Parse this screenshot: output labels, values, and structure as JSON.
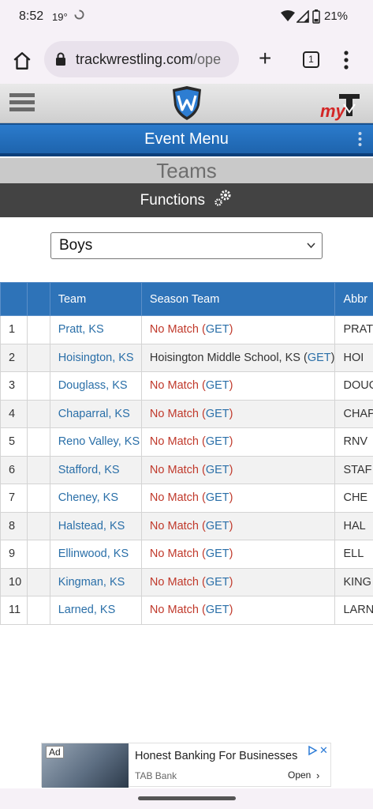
{
  "status_bar": {
    "time": "8:52",
    "temperature": "19°",
    "battery": "21%"
  },
  "browser": {
    "url_host": "trackwrestling.com",
    "url_path": "/ope",
    "tab_count": "1"
  },
  "site": {
    "event_menu_label": "Event Menu",
    "section_title": "Teams",
    "functions_label": "Functions",
    "division_select": {
      "selected": "Boys"
    }
  },
  "table": {
    "headers": [
      "",
      "",
      "Team",
      "Season Team",
      "Abbr"
    ],
    "rows": [
      {
        "num": "1",
        "team": "Pratt, KS",
        "season_match": "No Match",
        "season_get": "GET",
        "matched": false,
        "abbr": "PRAT"
      },
      {
        "num": "2",
        "team": "Hoisington, KS",
        "season_match": "Hoisington Middle School, KS",
        "season_get": "GET",
        "matched": true,
        "abbr": "HOI"
      },
      {
        "num": "3",
        "team": "Douglass, KS",
        "season_match": "No Match",
        "season_get": "GET",
        "matched": false,
        "abbr": "DOUG"
      },
      {
        "num": "4",
        "team": "Chaparral, KS",
        "season_match": "No Match",
        "season_get": "GET",
        "matched": false,
        "abbr": "CHAP"
      },
      {
        "num": "5",
        "team": "Reno Valley, KS",
        "season_match": "No Match",
        "season_get": "GET",
        "matched": false,
        "abbr": "RNV"
      },
      {
        "num": "6",
        "team": "Stafford, KS",
        "season_match": "No Match",
        "season_get": "GET",
        "matched": false,
        "abbr": "STAF"
      },
      {
        "num": "7",
        "team": "Cheney, KS",
        "season_match": "No Match",
        "season_get": "GET",
        "matched": false,
        "abbr": "CHE"
      },
      {
        "num": "8",
        "team": "Halstead, KS",
        "season_match": "No Match",
        "season_get": "GET",
        "matched": false,
        "abbr": "HAL"
      },
      {
        "num": "9",
        "team": "Ellinwood, KS",
        "season_match": "No Match",
        "season_get": "GET",
        "matched": false,
        "abbr": "ELL"
      },
      {
        "num": "10",
        "team": "Kingman, KS",
        "season_match": "No Match",
        "season_get": "GET",
        "matched": false,
        "abbr": "KING"
      },
      {
        "num": "11",
        "team": "Larned, KS",
        "season_match": "No Match",
        "season_get": "GET",
        "matched": false,
        "abbr": "LARN"
      }
    ]
  },
  "ad": {
    "badge": "Ad",
    "headline": "Honest Banking For Businesses",
    "advertiser": "TAB Bank",
    "cta": "Open"
  },
  "colors": {
    "header_blue": "#2e73b8",
    "event_menu_blue": "#1e64ad",
    "link_blue": "#2a6fa8",
    "no_match_red": "#c0392b",
    "functions_dark": "#434343"
  }
}
